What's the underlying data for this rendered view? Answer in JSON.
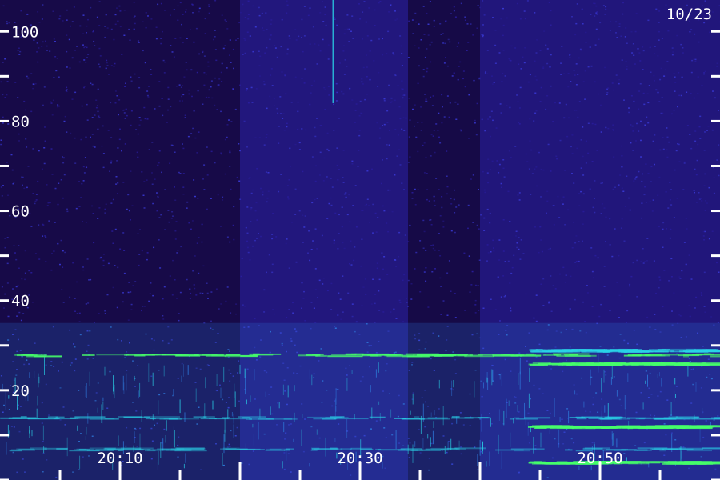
{
  "date_label": "10/23",
  "colors": {
    "background": "#14093d",
    "noise_dark": "#1a0d52",
    "noise_mid": "#2a1ea0",
    "noise_bright": "#3a3ad8",
    "band_blue": "#2f7de0",
    "band_cyan": "#2ad4e8",
    "band_green": "#46ff6a",
    "axis": "#ffffff"
  },
  "chart_data": {
    "type": "heatmap",
    "title": "",
    "xlabel": "",
    "ylabel": "",
    "date": "10/23",
    "x_range": [
      "20:02",
      "20:62"
    ],
    "y_range": [
      0,
      107
    ],
    "y_ticks": [
      {
        "value": 0,
        "label": ""
      },
      {
        "value": 10,
        "label": ""
      },
      {
        "value": 20,
        "label": "20"
      },
      {
        "value": 30,
        "label": ""
      },
      {
        "value": 40,
        "label": "40"
      },
      {
        "value": 50,
        "label": ""
      },
      {
        "value": 60,
        "label": "60"
      },
      {
        "value": 70,
        "label": ""
      },
      {
        "value": 80,
        "label": "80"
      },
      {
        "value": 90,
        "label": ""
      },
      {
        "value": 100,
        "label": "100"
      }
    ],
    "x_ticks": [
      {
        "minute": 10,
        "label": "20:10"
      },
      {
        "minute": 30,
        "label": "20:30"
      },
      {
        "minute": 50,
        "label": "20:50"
      }
    ],
    "time_segments": [
      {
        "start_min": 0,
        "end_min": 20,
        "level": 0.45
      },
      {
        "start_min": 20,
        "end_min": 34,
        "level": 0.6
      },
      {
        "start_min": 34,
        "end_min": 40,
        "level": 0.25
      },
      {
        "start_min": 40,
        "end_min": 60,
        "level": 0.55
      }
    ],
    "bands": [
      {
        "y": 28,
        "start_min": 0,
        "end_min": 60,
        "intensity": 0.9,
        "color": "green"
      },
      {
        "y": 29,
        "start_min": 44,
        "end_min": 59,
        "intensity": 0.8,
        "color": "cyan"
      },
      {
        "y": 26,
        "start_min": 44,
        "end_min": 59,
        "intensity": 0.8,
        "color": "green"
      },
      {
        "y": 14,
        "start_min": 0,
        "end_min": 60,
        "intensity": 0.6,
        "color": "cyan"
      },
      {
        "y": 12,
        "start_min": 44,
        "end_min": 59,
        "intensity": 1.0,
        "color": "green"
      },
      {
        "y": 7,
        "start_min": 0,
        "end_min": 60,
        "intensity": 0.5,
        "color": "cyan"
      },
      {
        "y": 4,
        "start_min": 44,
        "end_min": 59,
        "intensity": 0.9,
        "color": "green"
      }
    ],
    "vertical_line": {
      "minute": 27.7,
      "y_from": 84,
      "y_to": 107
    }
  }
}
